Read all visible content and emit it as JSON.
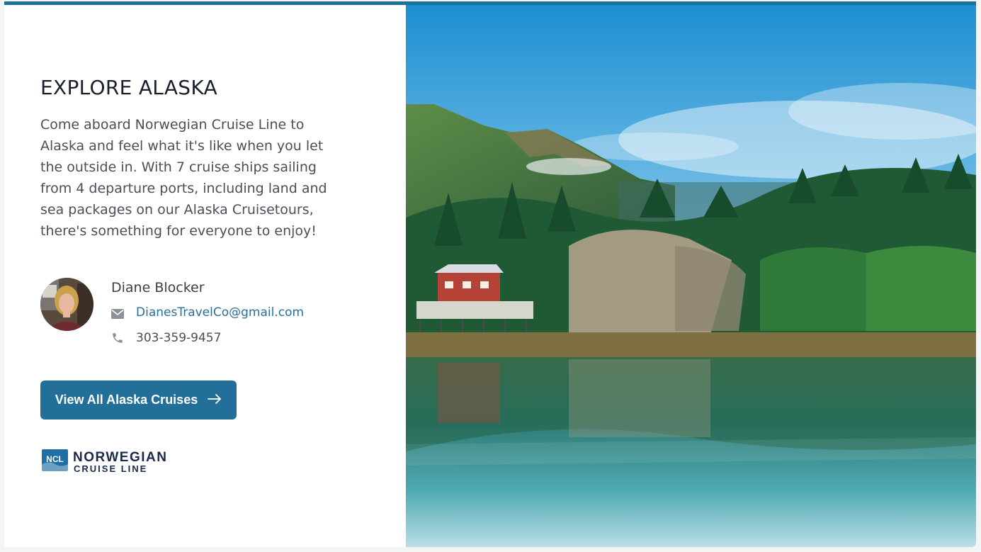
{
  "promo": {
    "title": "EXPLORE ALASKA",
    "description": "Come aboard Norwegian Cruise Line to Alaska and feel what it's like when you let the outside in. With 7 cruise ships sailing from 4 departure ports, including land and sea packages on our Alaska Cruisetours, there's something for everyone to enjoy!",
    "cta_label": "View All Alaska Cruises",
    "cta_icon": "arrow-right-icon"
  },
  "agent": {
    "name": "Diane Blocker",
    "email": "DianesTravelCo@gmail.com",
    "phone": "303-359-9457",
    "email_icon": "envelope-icon",
    "phone_icon": "phone-icon"
  },
  "brand": {
    "logo_badge": "NCL",
    "logo_line1": "NORWEGIAN",
    "logo_line2": "CRUISE LINE"
  },
  "colors": {
    "accent": "#226f9a",
    "link": "#2a6e9a",
    "heading": "#1a1f2e",
    "body_text": "#4a4f57"
  }
}
